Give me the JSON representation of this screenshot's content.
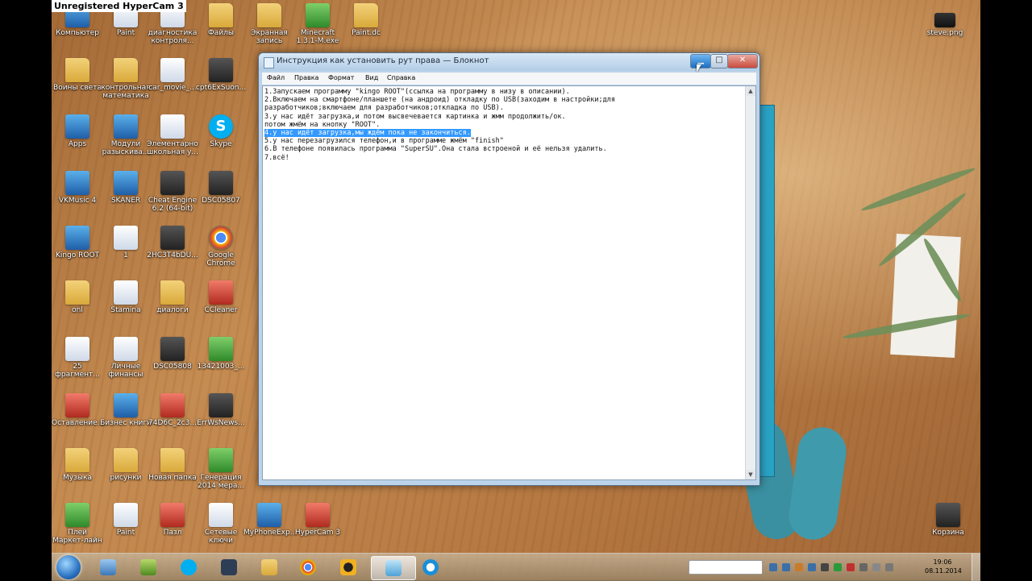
{
  "overlay": {
    "banner": "Unregistered HyperCam 3"
  },
  "desktop": {
    "icons": [
      {
        "label": "Компьютер",
        "kind": "app",
        "name": "computer-icon"
      },
      {
        "label": "Paint",
        "kind": "doc",
        "name": "paint-icon"
      },
      {
        "label": "диагностика контроля...",
        "kind": "doc",
        "name": "document-icon"
      },
      {
        "label": "Файлы",
        "kind": "folder",
        "name": "folder-icon"
      },
      {
        "label": "Экранная запись",
        "kind": "folder",
        "name": "folder-icon"
      },
      {
        "label": "Minecraft 1.3.1-М.exe",
        "kind": "green",
        "name": "minecraft-icon"
      },
      {
        "label": "Paint.dc",
        "kind": "folder",
        "name": "paint-dc-icon"
      },
      {
        "label": "steve.png",
        "kind": "steve",
        "name": "image-file-icon"
      },
      {
        "label": "Воины света",
        "kind": "folder",
        "name": "folder-icon"
      },
      {
        "label": "контрольная математика",
        "kind": "folder",
        "name": "folder-icon"
      },
      {
        "label": "car_movie_...",
        "kind": "doc",
        "name": "document-icon"
      },
      {
        "label": "cpt6ExSuon...",
        "kind": "dark",
        "name": "file-icon"
      },
      {
        "label": "Apps",
        "kind": "app",
        "name": "app-icon"
      },
      {
        "label": "Модули разыскива...",
        "kind": "app",
        "name": "app-icon"
      },
      {
        "label": "Элементарно школьная у...",
        "kind": "doc",
        "name": "document-icon"
      },
      {
        "label": "Skype",
        "kind": "skype",
        "name": "skype-icon"
      },
      {
        "label": "VKMusic 4",
        "kind": "app",
        "name": "vkmusic-icon"
      },
      {
        "label": "SKANER",
        "kind": "app",
        "name": "app-icon"
      },
      {
        "label": "Cheat Engine 6.2 (64-bit)",
        "kind": "dark",
        "name": "cheat-engine-icon"
      },
      {
        "label": "DSC05807",
        "kind": "dark",
        "name": "image-file-icon"
      },
      {
        "label": "Kingo ROOT",
        "kind": "app",
        "name": "kingo-root-icon"
      },
      {
        "label": "1",
        "kind": "doc",
        "name": "document-icon"
      },
      {
        "label": "2HC3T4bDU...",
        "kind": "dark",
        "name": "file-icon"
      },
      {
        "label": "Google Chrome",
        "kind": "chrome",
        "name": "chrome-icon"
      },
      {
        "label": "onl",
        "kind": "folder",
        "name": "folder-icon"
      },
      {
        "label": "Stamina",
        "kind": "doc",
        "name": "stamina-icon"
      },
      {
        "label": "диалоги",
        "kind": "folder",
        "name": "folder-icon"
      },
      {
        "label": "CCleaner",
        "kind": "red",
        "name": "ccleaner-icon"
      },
      {
        "label": "25 фрагмент...",
        "kind": "doc",
        "name": "document-icon"
      },
      {
        "label": "Личные финансы",
        "kind": "doc",
        "name": "document-icon"
      },
      {
        "label": "DSC05808",
        "kind": "dark",
        "name": "image-file-icon"
      },
      {
        "label": "13421003_...",
        "kind": "green",
        "name": "file-icon"
      },
      {
        "label": "Оставление...",
        "kind": "red",
        "name": "file-icon"
      },
      {
        "label": "Бизнес книги",
        "kind": "app",
        "name": "app-icon"
      },
      {
        "label": "74D6C_2c3...",
        "kind": "red",
        "name": "file-icon"
      },
      {
        "label": "ErrWsNews...",
        "kind": "dark",
        "name": "file-icon"
      },
      {
        "label": "Музыка",
        "kind": "folder",
        "name": "folder-icon"
      },
      {
        "label": "рисунки",
        "kind": "folder",
        "name": "folder-icon"
      },
      {
        "label": "Новая папка",
        "kind": "folder",
        "name": "folder-icon"
      },
      {
        "label": "Генерация 2014 мера...",
        "kind": "green",
        "name": "excel-icon"
      },
      {
        "label": "Плей Маркет-лайн",
        "kind": "green",
        "name": "app-icon"
      },
      {
        "label": "Paint",
        "kind": "doc",
        "name": "paint-icon"
      },
      {
        "label": "Пазл",
        "kind": "red",
        "name": "app-icon"
      },
      {
        "label": "Сетевые ключи",
        "kind": "doc",
        "name": "app-icon"
      },
      {
        "label": "MyPhoneExp...",
        "kind": "app",
        "name": "app-icon"
      },
      {
        "label": "HyperCam 3",
        "kind": "red",
        "name": "hypercam-icon"
      },
      {
        "label": "Корзина",
        "kind": "dark",
        "name": "recycle-bin-icon"
      }
    ]
  },
  "notepad": {
    "title": "Инструкция как установить рут права — Блокнот",
    "buttons": {
      "minimize": "▁",
      "maximize": "□",
      "close": "✕"
    },
    "menu": [
      "Файл",
      "Правка",
      "Формат",
      "Вид",
      "Справка"
    ],
    "lines": [
      "1.Запускаем программу \"kingo ROOT\"(ссылка на программу в низу в описании).",
      "2.Включаем на смартфоне/планшете (на андроид) откладку по USB(заходим в настройки;для",
      "разработчиков;включаем для разработчиков;откладка по USB).",
      "3.у нас идёт загрузка,и потом высвечевается картинка и жмм продолжить/ок.",
      "потом жмём на кнопку \"ROOT\".",
      "4.у нас идёт загрузка,мы ждём пока не закончиться.",
      "5.у нас перезагрузился телефон,и в программе жмём \"finish\"",
      "6.В телефоне появилась программа \"SuperSU\".Она стала встроеной и её нельзя удалить.",
      "7.всё!"
    ],
    "selected_line": 5
  },
  "taskbar": {
    "clock_time": "19:06",
    "clock_date": "08.11.2014"
  },
  "colors": {
    "selection": "#3399ff",
    "close_button": "#c94b3c",
    "accent": "#1b6fc2"
  }
}
